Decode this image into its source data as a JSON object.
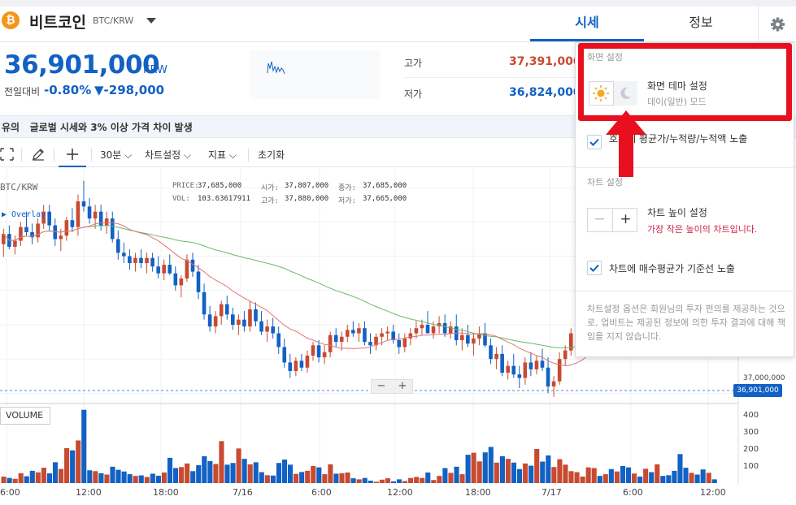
{
  "header": {
    "coin_symbol": "₿",
    "coin_name": "비트코인",
    "pair": "BTC/KRW",
    "tabs": [
      {
        "label": "시세",
        "active": true
      },
      {
        "label": "정보",
        "active": false
      }
    ]
  },
  "ticker": {
    "price": "36,901,000",
    "unit": "KRW",
    "change_label": "전일대비",
    "change_rate": "-0.80%",
    "change_amount": "▼-298,000",
    "high_label": "고가",
    "high_value": "37,391,000",
    "low_label": "저가",
    "low_value": "36,824,000"
  },
  "notice": {
    "text": "유의   글로벌 시세와 3% 이상 가격 차이 발생"
  },
  "toolbar": {
    "interval": "30분 ⌵",
    "chart_settings": "차트설정 ⌵",
    "indicators": "지표 ⌵",
    "reset": "초기화"
  },
  "chart_info": {
    "pair": "BTC/KRW",
    "overlay": "▶ Overlay",
    "price_label": "PRICE:",
    "price": "37,685,000",
    "open_label": "시가:",
    "open": "37,807,000",
    "close_label": "종가:",
    "close": "37,685,000",
    "vol_label": "VOL:",
    "vol": "103.63617911",
    "high_label": "고가:",
    "high": "37,880,000",
    "low_label": "저가:",
    "low": "37,665,000",
    "volume_title": "VOLUME",
    "price_axis_37m": "37,000,000",
    "current_price_tag": "36,901,000",
    "zoom_minus": "−",
    "zoom_plus": "+"
  },
  "volume_axis": [
    "400",
    "300",
    "200",
    "100"
  ],
  "time_axis": [
    "6:00",
    "12:00",
    "18:00",
    "7/16",
    "6:00",
    "12:00",
    "18:00",
    "7/17",
    "6:00",
    "12:00"
  ],
  "settings_panel": {
    "screen_section": "화면 설정",
    "theme_title": "화면 테마 설정",
    "theme_sub": "데이(일반) 모드",
    "orderbook_option": "호가에 평균가/누적량/누적액 노출",
    "chart_section": "차트 설정",
    "height_title": "차트 높이 설정",
    "height_warning": "가장 작은 높이의 차트입니다.",
    "height_minus": "−",
    "height_plus": "+",
    "avg_buy_option": "차트에 매수평균가 기준선 노출",
    "disclaimer": "차트설정 옵션은 회원님의 투자 편의를 제공하는 것으로, 업비트는 제공된 정보에 의한 투자 결과에 대해 책임을 지지 않습니다."
  },
  "colors": {
    "accent": "#1261c4",
    "up": "#c84a31",
    "down": "#1261c4",
    "highlight": "#e8101e",
    "ma_short": "#e57373",
    "ma_long": "#66bb6a"
  },
  "candles": [
    [
      37470000,
      37560000,
      37395000,
      37530000,
      38
    ],
    [
      37530000,
      37580000,
      37440000,
      37455000,
      30
    ],
    [
      37455000,
      37520000,
      37410000,
      37490000,
      25
    ],
    [
      37490000,
      37600000,
      37460000,
      37570000,
      58
    ],
    [
      37570000,
      37660000,
      37520000,
      37540000,
      40
    ],
    [
      37540000,
      37590000,
      37470000,
      37510000,
      72
    ],
    [
      37510000,
      37620000,
      37480000,
      37590000,
      63
    ],
    [
      37590000,
      37700000,
      37560000,
      37660000,
      90
    ],
    [
      37660000,
      37700000,
      37550000,
      37580000,
      57
    ],
    [
      37580000,
      37620000,
      37460000,
      37500000,
      122
    ],
    [
      37500000,
      37560000,
      37430000,
      37520000,
      83
    ],
    [
      37520000,
      37630000,
      37490000,
      37610000,
      205
    ],
    [
      37610000,
      37680000,
      37540000,
      37570000,
      192
    ],
    [
      37570000,
      37760000,
      37520000,
      37720000,
      250
    ],
    [
      37720000,
      37840000,
      37660000,
      37690000,
      430
    ],
    [
      37690000,
      37740000,
      37590000,
      37620000,
      75
    ],
    [
      37620000,
      37700000,
      37560000,
      37660000,
      70
    ],
    [
      37660000,
      37700000,
      37550000,
      37580000,
      58
    ],
    [
      37580000,
      37660000,
      37530000,
      37620000,
      50
    ],
    [
      37620000,
      37660000,
      37480000,
      37500000,
      96
    ],
    [
      37500000,
      37550000,
      37380000,
      37420000,
      78
    ],
    [
      37420000,
      37480000,
      37360000,
      37400000,
      68
    ],
    [
      37400000,
      37440000,
      37320000,
      37360000,
      52
    ],
    [
      37360000,
      37420000,
      37310000,
      37390000,
      42
    ],
    [
      37390000,
      37440000,
      37330000,
      37360000,
      45
    ],
    [
      37360000,
      37420000,
      37300000,
      37390000,
      36
    ],
    [
      37390000,
      37420000,
      37310000,
      37340000,
      55
    ],
    [
      37340000,
      37400000,
      37270000,
      37300000,
      43
    ],
    [
      37300000,
      37380000,
      37260000,
      37350000,
      62
    ],
    [
      37350000,
      37410000,
      37290000,
      37300000,
      148
    ],
    [
      37300000,
      37340000,
      37200000,
      37230000,
      88
    ],
    [
      37230000,
      37290000,
      37160000,
      37270000,
      94
    ],
    [
      37270000,
      37410000,
      37250000,
      37380000,
      115
    ],
    [
      37380000,
      37420000,
      37280000,
      37310000,
      70
    ],
    [
      37310000,
      37350000,
      37150000,
      37190000,
      105
    ],
    [
      37190000,
      37240000,
      37030000,
      37060000,
      158
    ],
    [
      37060000,
      37110000,
      36960000,
      36990000,
      129
    ],
    [
      36990000,
      37080000,
      36950000,
      37050000,
      112
    ],
    [
      37050000,
      37140000,
      37000000,
      37120000,
      246
    ],
    [
      37120000,
      37170000,
      37030000,
      37060000,
      108
    ],
    [
      37060000,
      37100000,
      36970000,
      37000000,
      118
    ],
    [
      37000000,
      37060000,
      36940000,
      37030000,
      203
    ],
    [
      37030000,
      37080000,
      36960000,
      36990000,
      142
    ],
    [
      36990000,
      37140000,
      36960000,
      37090000,
      110
    ],
    [
      37090000,
      37130000,
      36990000,
      37020000,
      122
    ],
    [
      37020000,
      37080000,
      36940000,
      36960000,
      64
    ],
    [
      36960000,
      37030000,
      36900000,
      36990000,
      46
    ],
    [
      36990000,
      37040000,
      36920000,
      36950000,
      44
    ],
    [
      36950000,
      36990000,
      36830000,
      36870000,
      118
    ],
    [
      36870000,
      36920000,
      36750000,
      36780000,
      138
    ],
    [
      36780000,
      36830000,
      36690000,
      36730000,
      108
    ],
    [
      36730000,
      36810000,
      36700000,
      36790000,
      54
    ],
    [
      36790000,
      36830000,
      36730000,
      36750000,
      65
    ],
    [
      36750000,
      36850000,
      36720000,
      36820000,
      72
    ],
    [
      36820000,
      36900000,
      36790000,
      36880000,
      100
    ],
    [
      36880000,
      36910000,
      36780000,
      36810000,
      92
    ],
    [
      36810000,
      36880000,
      36770000,
      36840000,
      52
    ],
    [
      36840000,
      36960000,
      36810000,
      36940000,
      110
    ],
    [
      36940000,
      36980000,
      36870000,
      36900000,
      55
    ],
    [
      36900000,
      36960000,
      36850000,
      36930000,
      58
    ],
    [
      36930000,
      37000000,
      36900000,
      36970000,
      62
    ],
    [
      36970000,
      37020000,
      36930000,
      36950000,
      28
    ],
    [
      36950000,
      37010000,
      36900000,
      36980000,
      22
    ],
    [
      36980000,
      37020000,
      36880000,
      36900000,
      30
    ],
    [
      36900000,
      36950000,
      36830000,
      36880000,
      14
    ],
    [
      36880000,
      36950000,
      36850000,
      36930000,
      8
    ],
    [
      36930000,
      36980000,
      36880000,
      36950000,
      20
    ],
    [
      36950000,
      36990000,
      36910000,
      36960000,
      28
    ],
    [
      36960000,
      37000000,
      36890000,
      36910000,
      10
    ],
    [
      36910000,
      36950000,
      36830000,
      36870000,
      22
    ],
    [
      36870000,
      36950000,
      36840000,
      36920000,
      12
    ],
    [
      36920000,
      36980000,
      36880000,
      36950000,
      30
    ],
    [
      36950000,
      37020000,
      36920000,
      36980000,
      36
    ],
    [
      36980000,
      37030000,
      36940000,
      37000000,
      30
    ],
    [
      37000000,
      37080000,
      36960000,
      36950000,
      62
    ],
    [
      36950000,
      37020000,
      36920000,
      36990000,
      18
    ],
    [
      36990000,
      37050000,
      36950000,
      37010000,
      42
    ],
    [
      37010000,
      37060000,
      36930000,
      36950000,
      88
    ],
    [
      36950000,
      37020000,
      36920000,
      36990000,
      60
    ],
    [
      36990000,
      37060000,
      36880000,
      36910000,
      96
    ],
    [
      36910000,
      36980000,
      36850000,
      36940000,
      52
    ],
    [
      36940000,
      37000000,
      36870000,
      36890000,
      166
    ],
    [
      36890000,
      36950000,
      36820000,
      36920000,
      178
    ],
    [
      36920000,
      36990000,
      36880000,
      36950000,
      127
    ],
    [
      36950000,
      37010000,
      36870000,
      36880000,
      180
    ],
    [
      36880000,
      36920000,
      36770000,
      36800000,
      212
    ],
    [
      36800000,
      36870000,
      36740000,
      36830000,
      120
    ],
    [
      36830000,
      36880000,
      36700000,
      36720000,
      158
    ],
    [
      36720000,
      36790000,
      36680000,
      36760000,
      142
    ],
    [
      36760000,
      36830000,
      36690000,
      36710000,
      120
    ],
    [
      36710000,
      36760000,
      36630000,
      36690000,
      82
    ],
    [
      36690000,
      36810000,
      36650000,
      36780000,
      115
    ],
    [
      36780000,
      36840000,
      36700000,
      36740000,
      102
    ],
    [
      36740000,
      36820000,
      36710000,
      36790000,
      200
    ],
    [
      36790000,
      36860000,
      36730000,
      36750000,
      126
    ],
    [
      36750000,
      36810000,
      36600000,
      36640000,
      162
    ],
    [
      36640000,
      36700000,
      36580000,
      36670000,
      94
    ],
    [
      36670000,
      36840000,
      36650000,
      36800000,
      140
    ],
    [
      36800000,
      36880000,
      36760000,
      36850000,
      108
    ],
    [
      36850000,
      36980000,
      36820000,
      36950000,
      70
    ],
    [
      36950000,
      37040000,
      36910000,
      36990000,
      64
    ],
    [
      36990000,
      37100000,
      36960000,
      37080000,
      38
    ],
    [
      37080000,
      37180000,
      37030000,
      37150000,
      92
    ],
    [
      37150000,
      37250000,
      37100000,
      37220000,
      88
    ],
    [
      37220000,
      37280000,
      37150000,
      37180000,
      42
    ],
    [
      37180000,
      37260000,
      37150000,
      37240000,
      52
    ],
    [
      37240000,
      37300000,
      37170000,
      37200000,
      82
    ],
    [
      37200000,
      37300000,
      37160000,
      37270000,
      68
    ],
    [
      37270000,
      37360000,
      37210000,
      37240000,
      100
    ],
    [
      37240000,
      37290000,
      37190000,
      37230000,
      92
    ],
    [
      37230000,
      37310000,
      37180000,
      37280000,
      56
    ],
    [
      37280000,
      37330000,
      37210000,
      37250000,
      38
    ],
    [
      37250000,
      37310000,
      37200000,
      37290000,
      84
    ],
    [
      37290000,
      37350000,
      37230000,
      37260000,
      64
    ],
    [
      37260000,
      37330000,
      37200000,
      37310000,
      110
    ],
    [
      37310000,
      37360000,
      37270000,
      37290000,
      42
    ],
    [
      37290000,
      37330000,
      37230000,
      37250000,
      46
    ],
    [
      37250000,
      37310000,
      37150000,
      37180000,
      72
    ],
    [
      37180000,
      37230000,
      37060000,
      37100000,
      170
    ],
    [
      37100000,
      37160000,
      36960000,
      37000000,
      90
    ],
    [
      37000000,
      37100000,
      36930000,
      37060000,
      60
    ],
    [
      37060000,
      37110000,
      36950000,
      36990000,
      50
    ],
    [
      36990000,
      37040000,
      36920000,
      36930000,
      80
    ],
    [
      36930000,
      37000000,
      36890000,
      36960000,
      60
    ],
    [
      36960000,
      37020000,
      36900000,
      36950000,
      22
    ]
  ]
}
